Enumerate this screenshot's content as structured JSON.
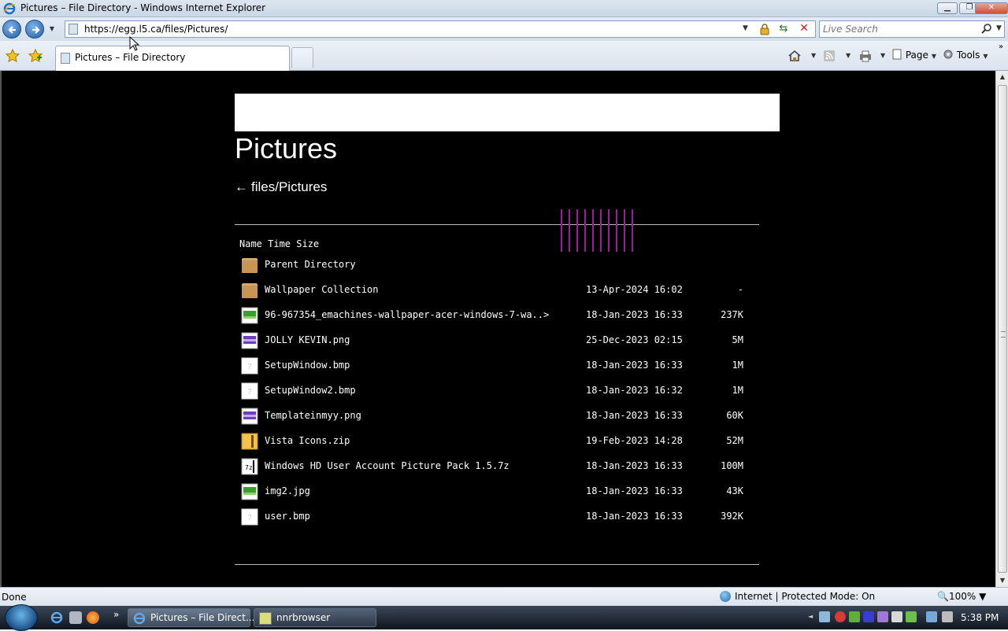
{
  "window": {
    "title": "Pictures – File Directory - Windows Internet Explorer",
    "controls": [
      "minimize",
      "restore",
      "close"
    ]
  },
  "address_bar": {
    "url": "https://egg.l5.ca/files/Pictures/",
    "search_placeholder": "Live Search"
  },
  "tab": {
    "label": "Pictures – File Directory"
  },
  "command_bar": {
    "page_label": "Page",
    "tools_label": "Tools"
  },
  "page": {
    "title": "Pictures",
    "breadcrumb_arrow": "←",
    "breadcrumb_path": "files/Pictures",
    "list_header": "Name Time Size",
    "rows": [
      {
        "name": "Parent Directory",
        "date": "",
        "size": "",
        "icon": "folder-icon"
      },
      {
        "name": "Wallpaper Collection",
        "date": "13-Apr-2024 16:02",
        "size": "-",
        "icon": "folder-icon"
      },
      {
        "name": "96-967354_emachines-wallpaper-acer-windows-7-wa..>",
        "date": "18-Jan-2023 16:33",
        "size": "237K",
        "icon": "image-icon"
      },
      {
        "name": "JOLLY KEVIN.png",
        "date": "25-Dec-2023 02:15",
        "size": "5M",
        "icon": "png-icon"
      },
      {
        "name": "SetupWindow.bmp",
        "date": "18-Jan-2023 16:33",
        "size": "1M",
        "icon": "unknown-file-icon"
      },
      {
        "name": "SetupWindow2.bmp",
        "date": "18-Jan-2023 16:32",
        "size": "1M",
        "icon": "unknown-file-icon"
      },
      {
        "name": "Templateinmyy.png",
        "date": "18-Jan-2023 16:33",
        "size": "60K",
        "icon": "png-icon"
      },
      {
        "name": "Vista Icons.zip",
        "date": "19-Feb-2023 14:28",
        "size": "52M",
        "icon": "archive-icon"
      },
      {
        "name": "Windows HD User Account Picture Pack 1.5.7z",
        "date": "18-Jan-2023 16:33",
        "size": "100M",
        "icon": "archive-7z-icon"
      },
      {
        "name": "img2.jpg",
        "date": "18-Jan-2023 16:33",
        "size": "43K",
        "icon": "image-icon"
      },
      {
        "name": "user.bmp",
        "date": "18-Jan-2023 16:33",
        "size": "392K",
        "icon": "unknown-file-icon"
      }
    ]
  },
  "status_bar": {
    "status": "Done",
    "zone": "Internet | Protected Mode: On",
    "zoom": "100%"
  },
  "taskbar": {
    "buttons": [
      {
        "label": "Pictures – File Direct...",
        "icon": "ie-icon"
      },
      {
        "label": "nnrbrowser",
        "icon": "app-icon"
      }
    ],
    "clock": "5:38 PM"
  },
  "colors": {
    "content_background": "#000000",
    "text": "#ffffff",
    "decor_lines": "#a118a1",
    "folder": "#d7a868"
  }
}
